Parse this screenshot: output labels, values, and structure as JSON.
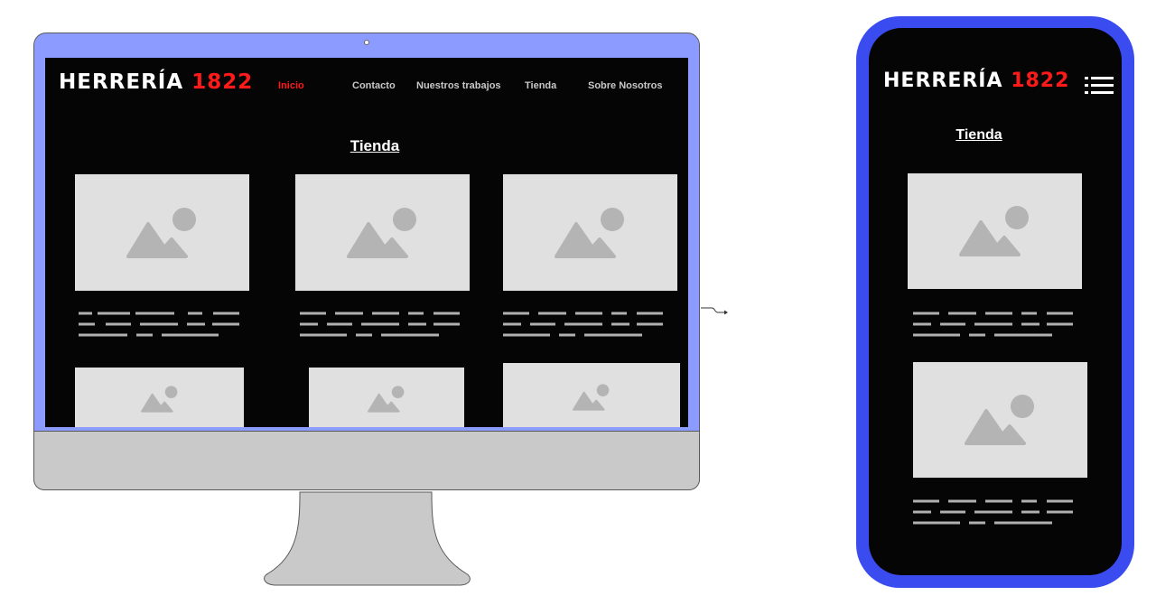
{
  "brand": {
    "name": "HERRERÍA",
    "year": "1822",
    "accent_color": "#ff1a1a"
  },
  "desktop": {
    "nav": [
      {
        "label": "Inicio",
        "active": true
      },
      {
        "label": "Contacto",
        "active": false
      },
      {
        "label": "Nuestros trabajos",
        "active": false
      },
      {
        "label": "Tienda",
        "active": false
      },
      {
        "label": "Sobre Nosotros",
        "active": false
      }
    ],
    "heading": "Tienda",
    "frame_color": "#8c9bff"
  },
  "mobile": {
    "heading": "Tienda",
    "menu_icon": "hamburger-menu-icon",
    "frame_color": "#3a4cf0"
  },
  "placeholder_icon": "image-placeholder-icon",
  "connector_icon": "arrow-right-icon"
}
